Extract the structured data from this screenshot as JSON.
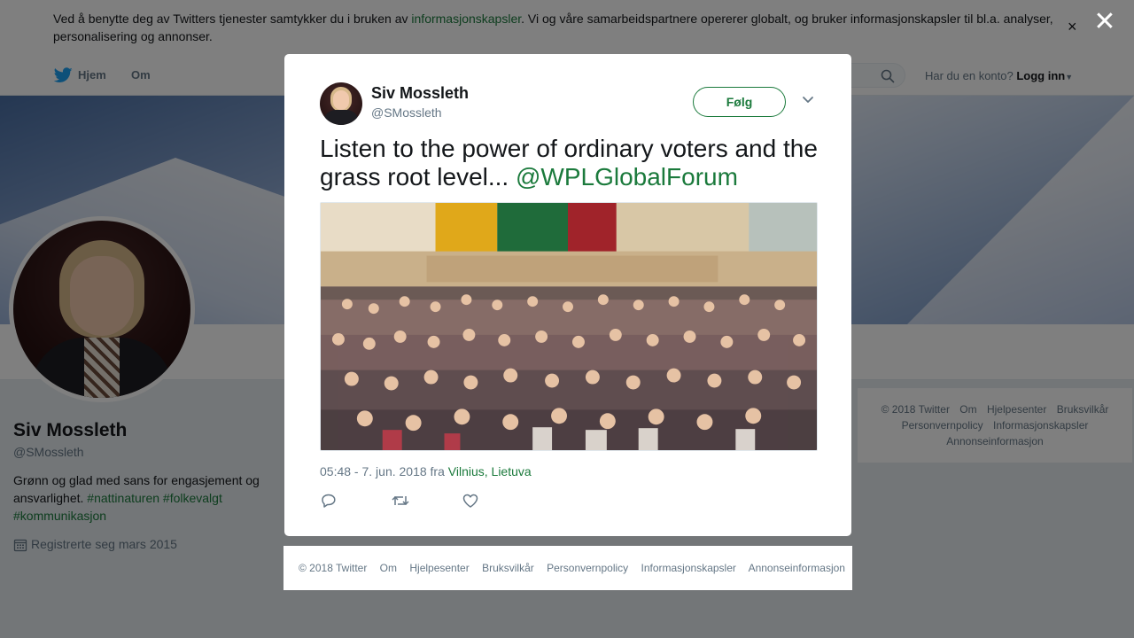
{
  "cookie_bar": {
    "text_before": "Ved å benytte deg av Twitters tjenester samtykker du i bruken av ",
    "link": "informasjonskapsler",
    "text_after": ". Vi og våre samarbeidspartnere opererer globalt, og bruker informasjonskapsler til bl.a. analyser, personalisering og annonser.",
    "close_glyph": "×"
  },
  "nav": {
    "home": "Hjem",
    "about": "Om",
    "login_prompt": "Har du en konto?",
    "login": "Logg inn"
  },
  "profile": {
    "name": "Siv Mossleth",
    "handle": "@SMossleth",
    "bio_text": "Grønn og glad med sans for engasjement og ansvarlighet. ",
    "hashtags": [
      "#nattinaturen",
      "#folkevalgt",
      "#kommunikasjon"
    ],
    "joined": "Registrerte seg mars 2015"
  },
  "side_footer": {
    "items": [
      "© 2018 Twitter",
      "Om",
      "Hjelpesenter",
      "Bruksvilkår",
      "Personvernpolicy",
      "Informasjonskapsler",
      "Annonseinformasjon"
    ]
  },
  "overlay": {
    "close_glyph": "✕"
  },
  "tweet": {
    "name": "Siv Mossleth",
    "handle": "@SMossleth",
    "follow_label": "Følg",
    "text": "Listen to the power of ordinary voters and the grass root level... ",
    "mention": "@WPLGlobalForum",
    "time": "05:48 - 7. jun. 2018 fra ",
    "location": "Vilnius, Lietuva"
  },
  "modal_footer": {
    "items": [
      "© 2018 Twitter",
      "Om",
      "Hjelpesenter",
      "Bruksvilkår",
      "Personvernpolicy",
      "Informasjonskapsler",
      "Annonseinformasjon"
    ]
  },
  "colors": {
    "accent": "#1b7a3c",
    "muted": "#657786",
    "twitter_blue": "#1da1f2"
  },
  "icons": [
    "twitter-bird-icon",
    "search-icon",
    "caret-down-icon",
    "calendar-icon",
    "close-icon",
    "chevron-down-icon",
    "reply-icon",
    "retweet-icon",
    "like-icon"
  ]
}
